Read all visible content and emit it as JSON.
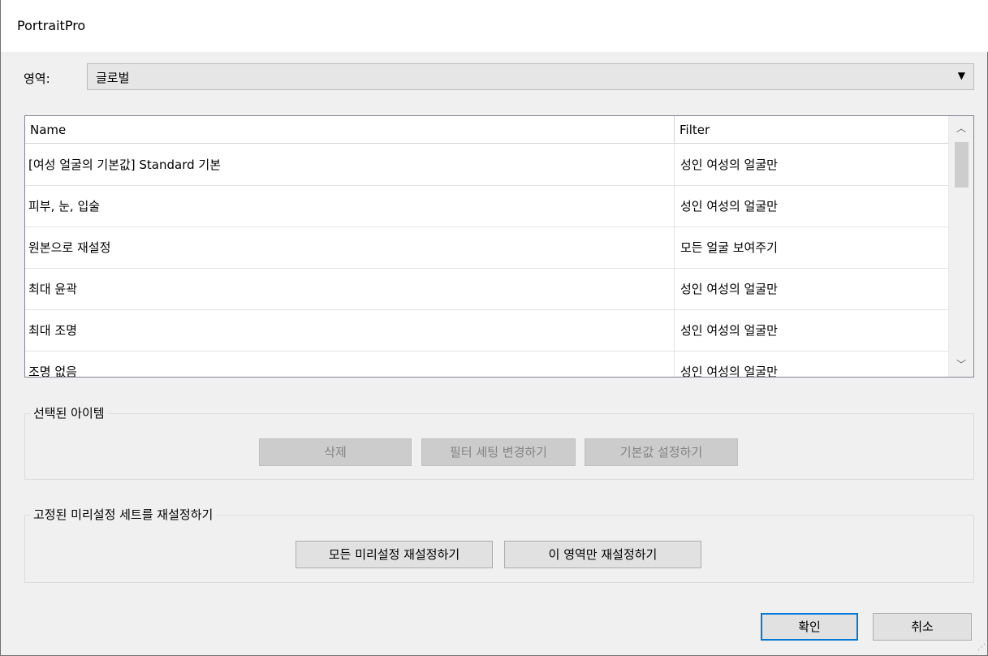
{
  "window": {
    "title": "PortraitPro"
  },
  "region": {
    "label": "영역:",
    "value": "글로벌"
  },
  "table": {
    "columns": {
      "name": "Name",
      "filter": "Filter"
    },
    "rows": [
      {
        "name": "[여성 얼굴의 기본값] Standard 기본",
        "filter": "성인 여성의 얼굴만"
      },
      {
        "name": "피부, 눈, 입술",
        "filter": "성인 여성의 얼굴만"
      },
      {
        "name": "원본으로 재설정",
        "filter": "모든 얼굴 보여주기"
      },
      {
        "name": "최대 윤곽",
        "filter": "성인 여성의 얼굴만"
      },
      {
        "name": "최대 조명",
        "filter": "성인 여성의 얼굴만"
      },
      {
        "name": "조명 없음",
        "filter": "성인 여성의 얼굴만"
      }
    ]
  },
  "selected_item": {
    "title": "선택된 아이템",
    "delete_label": "삭제",
    "change_filter_label": "필터 세팅 변경하기",
    "set_default_label": "기본값 설정하기"
  },
  "reset_presets": {
    "title": "고정된 미리설정 세트를 재설정하기",
    "reset_all_label": "모든 미리설정 재설정하기",
    "reset_region_label": "이 영역만 재설정하기"
  },
  "footer": {
    "ok_label": "확인",
    "cancel_label": "취소"
  }
}
